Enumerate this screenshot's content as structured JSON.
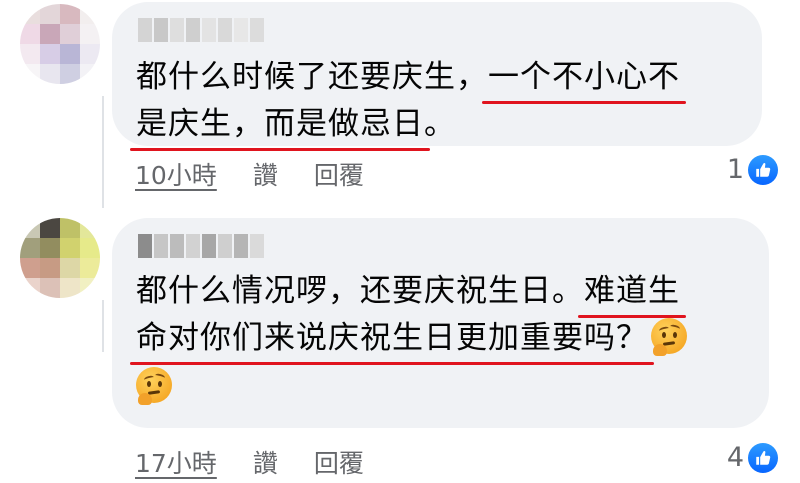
{
  "comments": [
    {
      "line1_a": "都什么时候了还要庆生，",
      "line1_b": "一个不小心不",
      "line2_a": "是庆生，而是做忌日",
      "line2_b": "。",
      "time": "10小時",
      "like": "讚",
      "reply": "回覆",
      "reactions": "1"
    },
    {
      "line1_a": "都什么情况啰，还要庆祝生日。",
      "line1_b": "难道生",
      "line2_a": "命对你们来说庆祝生日更加重要吗？",
      "time": "17小時",
      "like": "讚",
      "reply": "回覆",
      "reactions": "4"
    }
  ],
  "colors": {
    "bubble": "#f0f2f5",
    "underline": "#e0141e",
    "meta_text": "#65676b",
    "like_blue": "#0866ff"
  },
  "icons": [
    "like-thumb-icon",
    "thinking-face-emoji"
  ]
}
